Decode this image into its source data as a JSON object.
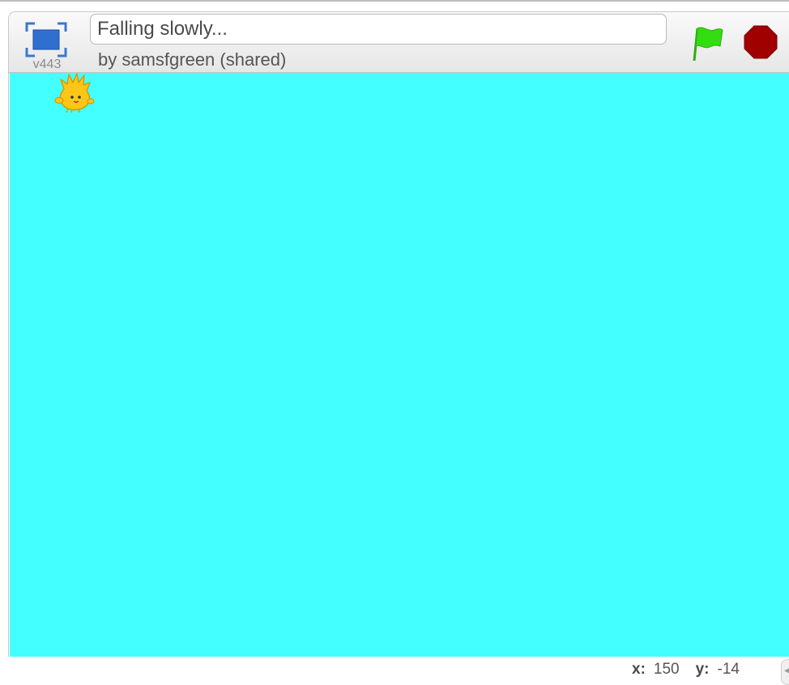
{
  "project": {
    "title": "Falling slowly...",
    "byline": "by samsfgreen (shared)",
    "version": "v443"
  },
  "controls": {
    "fullscreen_icon": "fullscreen-icon",
    "green_flag_icon": "green-flag-icon",
    "stop_icon": "stop-sign-icon"
  },
  "stage": {
    "background_color": "#44ffff",
    "sprite_icon": "gobo-sprite-icon"
  },
  "mouse_coords": {
    "x_label": "x:",
    "x_value": "150",
    "y_label": "y:",
    "y_value": "-14"
  },
  "colors": {
    "flag": "#33dd11",
    "stop": "#a10000",
    "fullscreen": "#3a78d0"
  }
}
